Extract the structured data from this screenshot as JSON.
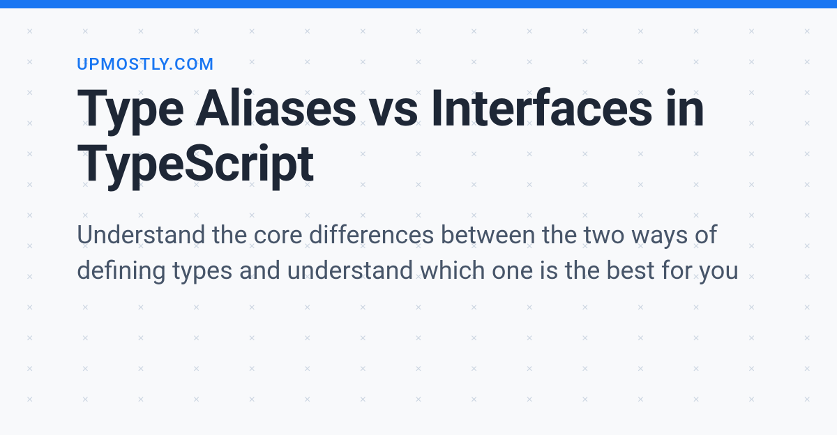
{
  "site_name": "UPMOSTLY.COM",
  "title": "Type Aliases vs Interfaces in TypeScript",
  "description": "Understand the core differences between the two ways of defining types and understand which one is the best for you",
  "colors": {
    "accent": "#1976f2",
    "title": "#1e2736",
    "body": "#475569",
    "background": "#f8f9fb",
    "pattern": "#cbd5e1"
  }
}
